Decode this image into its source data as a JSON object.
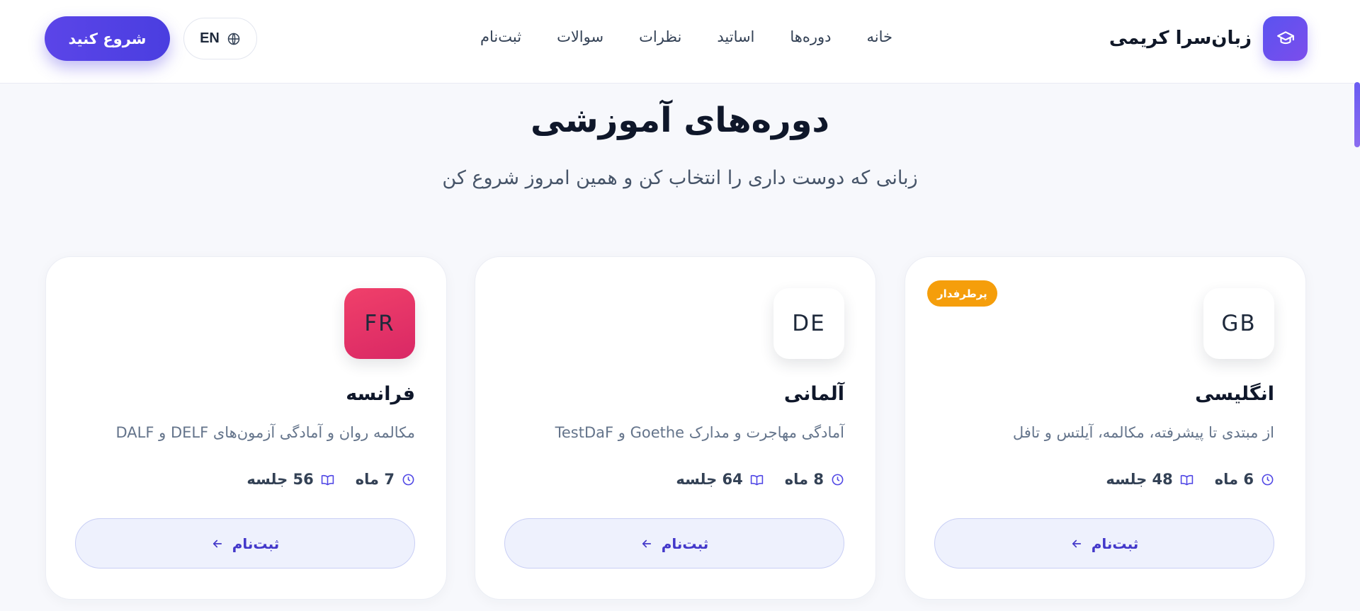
{
  "header": {
    "brand_name": "زبان‌سرا کریمی",
    "brand_icon": "graduation-cap-icon",
    "nav": [
      {
        "label": "خانه"
      },
      {
        "label": "دوره‌ها"
      },
      {
        "label": "اساتید"
      },
      {
        "label": "نظرات"
      },
      {
        "label": "سوالات"
      },
      {
        "label": "ثبت‌نام"
      }
    ],
    "lang_label": "EN",
    "lang_icon": "globe-icon",
    "cta_label": "شروع کنید"
  },
  "section": {
    "title": "دوره‌های آموزشی",
    "subtitle": "زبانی که دوست داری را انتخاب کن و همین امروز شروع کن"
  },
  "courses": [
    {
      "code": "GB",
      "badge": "پرطرفدار",
      "title": "انگلیسی",
      "description": "از مبتدی تا پیشرفته، مکالمه، آیلتس و تافل",
      "duration": "6 ماه",
      "sessions": "48 جلسه",
      "enroll_label": "ثبت‌نام"
    },
    {
      "code": "DE",
      "title": "آلمانی",
      "description": "آمادگی مهاجرت و مدارک Goethe و TestDaF",
      "duration": "8 ماه",
      "sessions": "64 جلسه",
      "enroll_label": "ثبت‌نام"
    },
    {
      "code": "FR",
      "title": "فرانسه",
      "description": "مکالمه روان و آمادگی آزمون‌های DELF و DALF",
      "duration": "7 ماه",
      "sessions": "56 جلسه",
      "enroll_label": "ثبت‌نام"
    }
  ],
  "colors": {
    "accent": "#4f46e5",
    "badge": "#f59e0b",
    "french_flag_bg": "#e0336a"
  }
}
